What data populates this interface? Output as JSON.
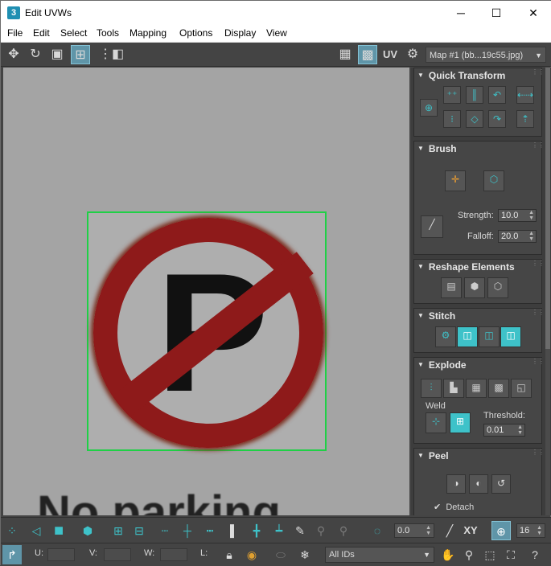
{
  "window": {
    "app_icon_text": "3",
    "title": "Edit UVWs",
    "minimize": "─",
    "maximize": "☐",
    "close": "✕"
  },
  "menu": [
    "File",
    "Edit",
    "Select",
    "Tools",
    "Mapping",
    "Options",
    "Display",
    "View"
  ],
  "toolbar": {
    "uv_label": "UV",
    "map_select": "Map #1 (bb...19c55.jpg)"
  },
  "viewport": {
    "sign_letter": "P",
    "caption": "No parking"
  },
  "panel": {
    "quick_transform": {
      "title": "Quick Transform"
    },
    "brush": {
      "title": "Brush",
      "strength_label": "Strength:",
      "strength_value": "10.0",
      "falloff_label": "Falloff:",
      "falloff_value": "20.0"
    },
    "reshape": {
      "title": "Reshape Elements"
    },
    "stitch": {
      "title": "Stitch"
    },
    "explode": {
      "title": "Explode",
      "weld_label": "Weld",
      "threshold_label": "Threshold:",
      "threshold_value": "0.01"
    },
    "peel": {
      "title": "Peel",
      "detach_label": "Detach",
      "detach_checked": true
    }
  },
  "bottom": {
    "angle_value": "0.0",
    "xy_label": "XY",
    "spin_value": "16",
    "u_label": "U:",
    "v_label": "V:",
    "w_label": "W:",
    "l_label": "L:",
    "ids_select": "All IDs"
  },
  "colors": {
    "accent": "#3ec2c9",
    "uv_border": "#1fd046",
    "sign_red": "#8e1a1a"
  }
}
